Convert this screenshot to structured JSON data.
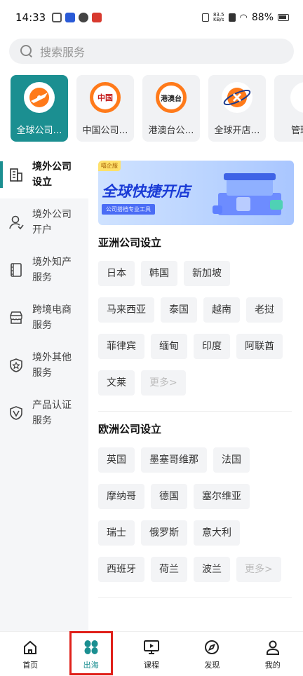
{
  "status_bar": {
    "time": "14:33",
    "net_speed_value": "83.5",
    "net_speed_unit": "KB/s",
    "battery": "88%"
  },
  "search": {
    "placeholder": "搜索服务"
  },
  "categories": [
    {
      "label": "全球公司…",
      "icon_text": "",
      "active": true
    },
    {
      "label": "中国公司…",
      "icon_text": "中国"
    },
    {
      "label": "港澳台公…",
      "icon_text": "港澳台"
    },
    {
      "label": "全球开店…",
      "icon_text": ""
    },
    {
      "label": "管理",
      "icon_text": ""
    }
  ],
  "sidebar": {
    "items": [
      {
        "label": "境外公司设立",
        "icon": "building-icon",
        "active": true
      },
      {
        "label": "境外公司开户",
        "icon": "user-icon"
      },
      {
        "label": "境外知产服务",
        "icon": "book-icon"
      },
      {
        "label": "跨境电商服务",
        "icon": "store-icon"
      },
      {
        "label": "境外其他服务",
        "icon": "shield-star-icon"
      },
      {
        "label": "产品认证服务",
        "icon": "verified-icon"
      }
    ]
  },
  "banner": {
    "tag": "嘻企服",
    "title": "全球快捷开店",
    "subtitle": "公司搭档专业工具"
  },
  "sections": [
    {
      "title": "亚洲公司设立",
      "tags": [
        "日本",
        "韩国",
        "新加坡",
        "马来西亚",
        "泰国",
        "越南",
        "老挝",
        "菲律宾",
        "缅甸",
        "印度",
        "阿联酋",
        "文莱"
      ],
      "more": "更多>"
    },
    {
      "title": "欧洲公司设立",
      "tags": [
        "英国",
        "墨塞哥维那",
        "法国",
        "摩纳哥",
        "德国",
        "塞尔维亚",
        "瑞士",
        "俄罗斯",
        "意大利",
        "西班牙",
        "荷兰",
        "波兰"
      ],
      "more": "更多>"
    }
  ],
  "bottom_nav": [
    {
      "label": "首页",
      "icon": "home-icon"
    },
    {
      "label": "出海",
      "icon": "grid-petals-icon",
      "active": true
    },
    {
      "label": "课程",
      "icon": "video-icon"
    },
    {
      "label": "发现",
      "icon": "compass-icon"
    },
    {
      "label": "我的",
      "icon": "person-icon"
    }
  ],
  "colors": {
    "accent": "#1b8f91",
    "highlight": "#e0201a",
    "banner_title": "#1a3bd6"
  }
}
